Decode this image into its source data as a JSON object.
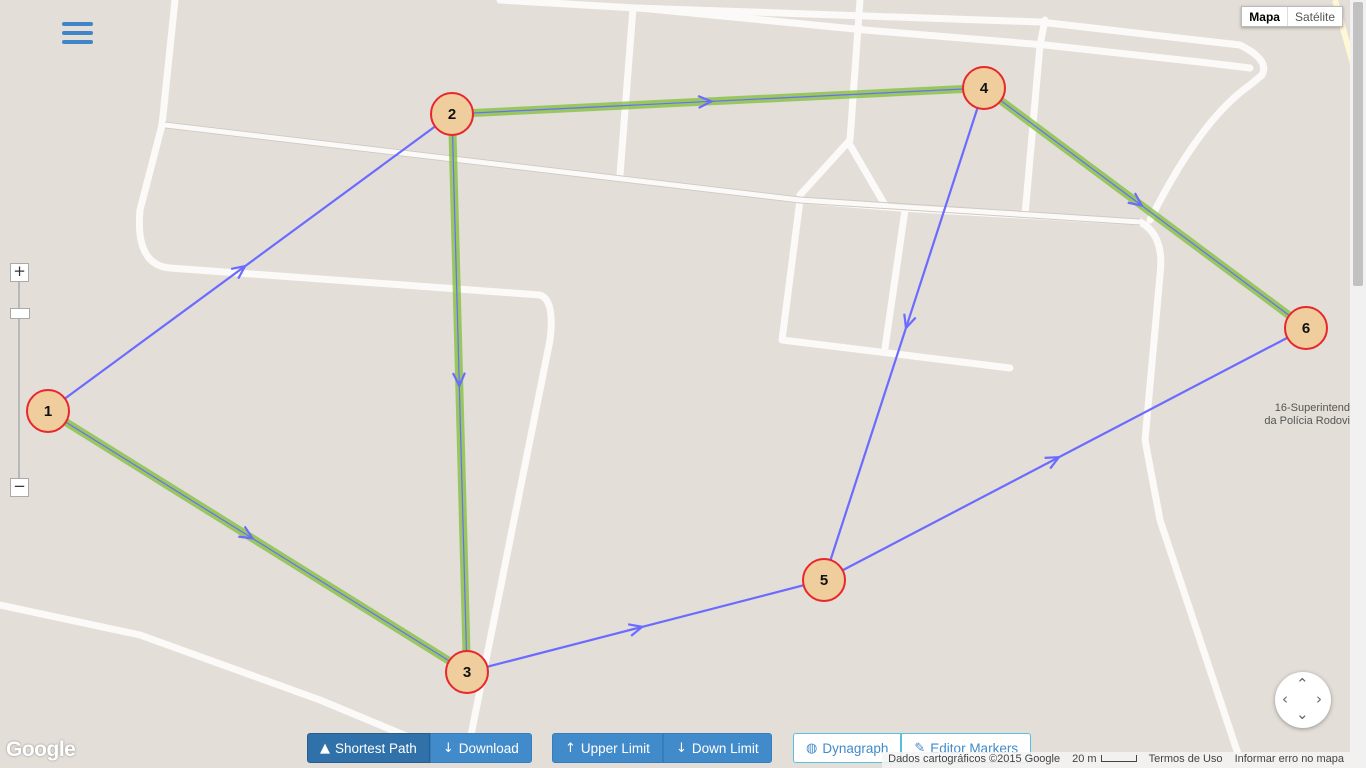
{
  "map_type": {
    "map_label": "Mapa",
    "satellite_label": "Satélite"
  },
  "place_label": {
    "line1": "16-Superintend",
    "line2": "da Polícia Rodovi"
  },
  "graph": {
    "nodes": [
      {
        "id": "1",
        "label": "1"
      },
      {
        "id": "2",
        "label": "2"
      },
      {
        "id": "3",
        "label": "3"
      },
      {
        "id": "4",
        "label": "4"
      },
      {
        "id": "5",
        "label": "5"
      },
      {
        "id": "6",
        "label": "6"
      }
    ],
    "edges": [
      {
        "from": "1",
        "to": "2",
        "in_shortest_path": false
      },
      {
        "from": "1",
        "to": "3",
        "in_shortest_path": true
      },
      {
        "from": "2",
        "to": "3",
        "in_shortest_path": true
      },
      {
        "from": "2",
        "to": "4",
        "in_shortest_path": true
      },
      {
        "from": "3",
        "to": "5",
        "in_shortest_path": false
      },
      {
        "from": "4",
        "to": "5",
        "in_shortest_path": false
      },
      {
        "from": "4",
        "to": "6",
        "in_shortest_path": true
      },
      {
        "from": "5",
        "to": "6",
        "in_shortest_path": false
      }
    ],
    "colors": {
      "edge": "#6b6bff",
      "path": "#8bc34a",
      "node_fill": "#f0cd9c",
      "node_stroke": "#e8262b"
    }
  },
  "toolbar": {
    "shortest_path": "Shortest Path",
    "download": "Download",
    "upper_limit": "Upper Limit",
    "down_limit": "Down Limit",
    "dynagraph": "Dynagraph",
    "editor_markers": "Editor Markers"
  },
  "attribution": {
    "logo": "Google",
    "data": "Dados cartográficos ©2015 Google",
    "scale": "20 m",
    "terms": "Termos de Uso",
    "report": "Informar erro no mapa"
  }
}
